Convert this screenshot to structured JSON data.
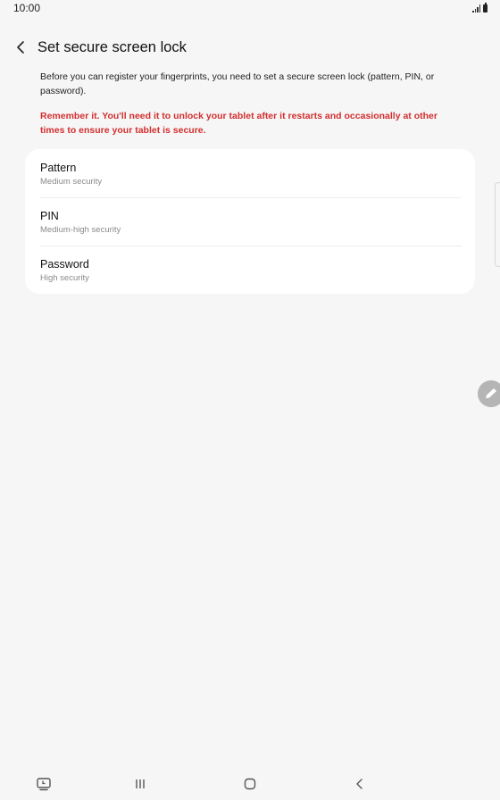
{
  "status_bar": {
    "time": "10:00"
  },
  "header": {
    "title": "Set secure screen lock",
    "back_icon": "chevron-left-icon"
  },
  "description": "Before you can register your fingerprints, you need to set a secure screen lock (pattern, PIN, or password).",
  "warning": "Remember it. You'll need it to unlock your tablet after it restarts and occasionally at other times to ensure your tablet is secure.",
  "options": [
    {
      "title": "Pattern",
      "subtitle": "Medium security"
    },
    {
      "title": "PIN",
      "subtitle": "Medium-high security"
    },
    {
      "title": "Password",
      "subtitle": "High security"
    }
  ],
  "nav_bar": {
    "icons": [
      "screen-capture-icon",
      "recents-icon",
      "home-icon",
      "back-icon"
    ]
  },
  "colors": {
    "background": "#f6f6f6",
    "warning": "#d32f2f",
    "card": "#ffffff"
  }
}
